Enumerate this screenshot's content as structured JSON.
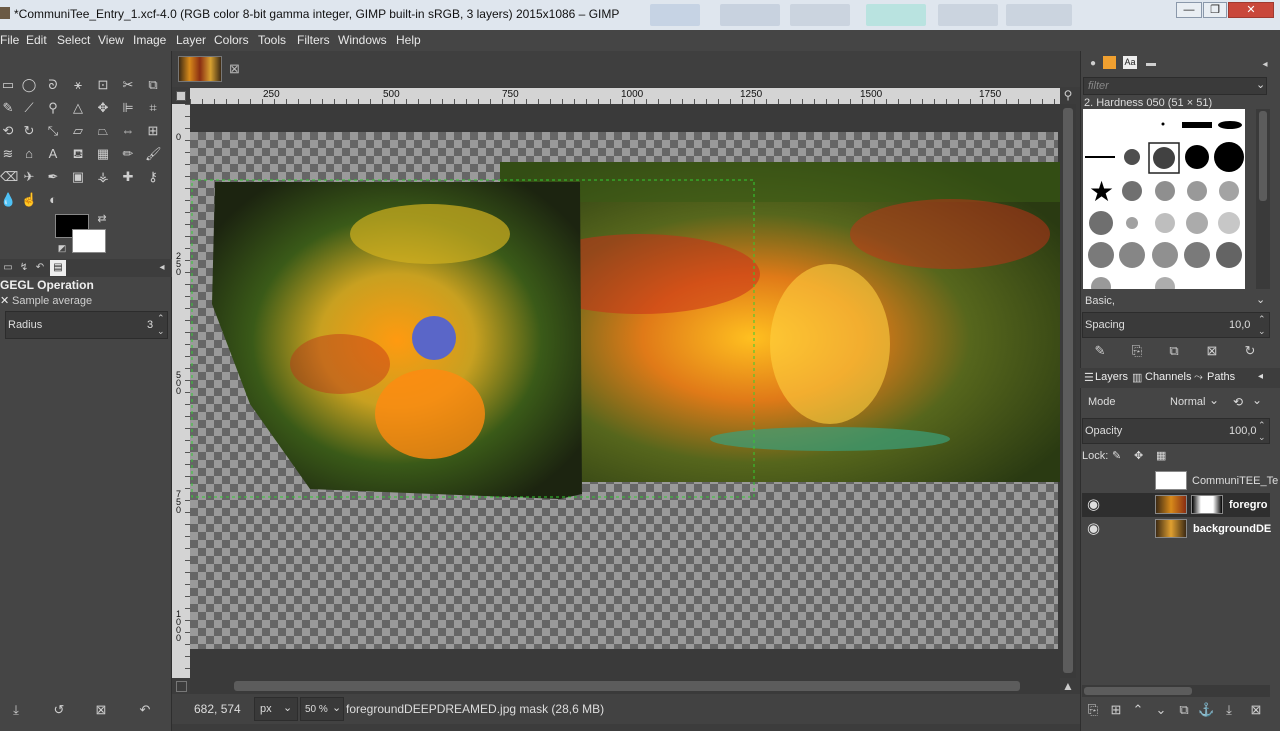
{
  "window": {
    "title": "*CommuniTee_Entry_1.xcf-4.0 (RGB color 8-bit gamma integer, GIMP built-in sRGB, 3 layers) 2015x1086 – GIMP",
    "controls": [
      "—",
      "❐",
      "✕"
    ]
  },
  "menubar": [
    "File",
    "Edit",
    "Select",
    "View",
    "Image",
    "Layer",
    "Colors",
    "Tools",
    "Filters",
    "Windows",
    "Help"
  ],
  "tool_options": {
    "title": "GEGL Operation",
    "sample_average_label": "Sample average",
    "radius_label": "Radius",
    "radius_value": "3"
  },
  "ruler_top_labels": [
    "250",
    "500",
    "750",
    "1000",
    "1250",
    "1500",
    "1750"
  ],
  "ruler_left_labels": [
    "0",
    "250",
    "500",
    "750",
    "1000"
  ],
  "statusbar": {
    "coords": "682, 574",
    "unit": "px",
    "zoom": "50 %",
    "message": "foregroundDEEPDREAMED.jpg mask (28,6 MB)"
  },
  "brushes": {
    "filter_placeholder": "filter",
    "current": "2. Hardness 050 (51 × 51)",
    "tag_preset": "Basic,",
    "spacing_label": "Spacing",
    "spacing_value": "10,0"
  },
  "layers_panel": {
    "tabs": [
      "Layers",
      "Channels",
      "Paths"
    ],
    "mode_label": "Mode",
    "mode_value": "Normal",
    "opacity_label": "Opacity",
    "opacity_value": "100,0",
    "lock_label": "Lock:",
    "layers": [
      {
        "name": "CommuniTEE_Te",
        "visible": false,
        "bold": false
      },
      {
        "name": "foregro",
        "visible": true,
        "bold": true
      },
      {
        "name": "backgroundDE",
        "visible": true,
        "bold": true
      }
    ]
  },
  "colors": {
    "accent_selection": "#33cc33",
    "panel_bg": "#454545"
  }
}
